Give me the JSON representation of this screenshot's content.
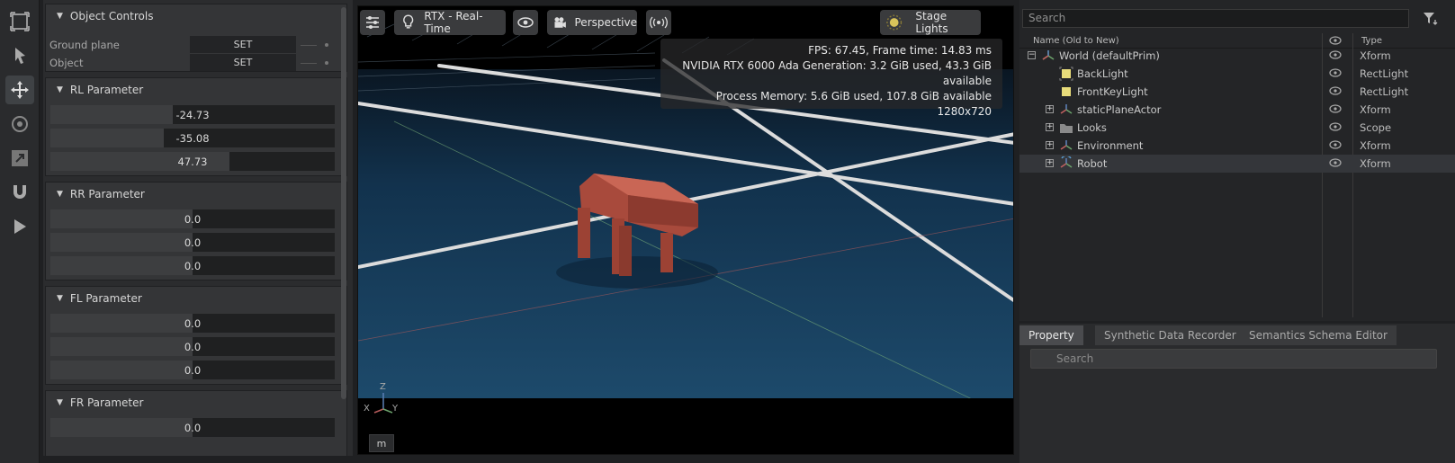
{
  "params": {
    "object_controls": {
      "title": "Object Controls",
      "rows": [
        {
          "label": "Ground plane",
          "button": "SET"
        },
        {
          "label": "Object",
          "button": "SET"
        }
      ]
    },
    "sections": [
      {
        "title": "RL Parameter",
        "values": [
          "-24.73",
          "-35.08",
          "47.73"
        ],
        "fills": [
          0.43,
          0.4,
          0.63
        ]
      },
      {
        "title": "RR Parameter",
        "values": [
          "0.0",
          "0.0",
          "0.0"
        ],
        "fills": [
          0.5,
          0.5,
          0.5
        ]
      },
      {
        "title": "FL Parameter",
        "values": [
          "0.0",
          "0.0",
          "0.0"
        ],
        "fills": [
          0.5,
          0.5,
          0.5
        ]
      },
      {
        "title": "FR Parameter",
        "values": [
          "0.0"
        ],
        "fills": [
          0.5
        ]
      }
    ]
  },
  "viewport": {
    "renderer": "RTX - Real-Time",
    "camera": "Perspective",
    "lights": "Stage Lights",
    "stats": {
      "fps": "FPS: 67.45, Frame time: 14.83 ms",
      "gpu": "NVIDIA RTX 6000 Ada Generation: 3.2 GiB used, 43.3 GiB available",
      "memory": "Process Memory: 5.6 GiB used, 107.8 GiB available",
      "resolution": "1280x720"
    },
    "axis": {
      "z": "Z",
      "x": "X",
      "y": "Y"
    },
    "unit": "m"
  },
  "stage": {
    "search_placeholder": "Search",
    "col_name": "Name (Old to New)",
    "col_type": "Type",
    "items": [
      {
        "name": "World (defaultPrim)",
        "type": "Xform",
        "icon": "xform-icon"
      },
      {
        "name": "BackLight",
        "type": "RectLight",
        "icon": "light-icon"
      },
      {
        "name": "FrontKeyLight",
        "type": "RectLight",
        "icon": "light-icon"
      },
      {
        "name": "staticPlaneActor",
        "type": "Xform",
        "icon": "xform-icon"
      },
      {
        "name": "Looks",
        "type": "Scope",
        "icon": "folder-icon"
      },
      {
        "name": "Environment",
        "type": "Xform",
        "icon": "xform-icon"
      },
      {
        "name": "Robot",
        "type": "Xform",
        "icon": "robot-icon"
      }
    ]
  },
  "property": {
    "tabs": [
      "Property",
      "Synthetic Data Recorder",
      "Semantics Schema Editor"
    ],
    "search_placeholder": "Search"
  }
}
